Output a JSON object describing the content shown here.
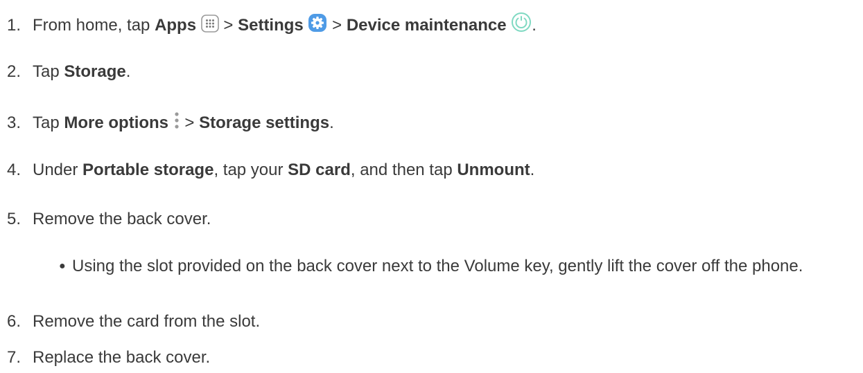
{
  "steps": [
    {
      "number": "1.",
      "t1": "From home, tap ",
      "b1": "Apps",
      "sep1": " > ",
      "b2": "Settings",
      "sep2": " > ",
      "b3": "Device maintenance",
      "end": ".",
      "icons": [
        "apps-grid-icon",
        "settings-gear-icon",
        "device-maintenance-icon"
      ]
    },
    {
      "number": "2.",
      "t1": "Tap ",
      "b1": "Storage",
      "end": "."
    },
    {
      "number": "3.",
      "t1": "Tap ",
      "b1": "More options",
      "sep1": " > ",
      "b2": "Storage settings",
      "end": ".",
      "icons": [
        "more-options-icon"
      ]
    },
    {
      "number": "4.",
      "t1": "Under ",
      "b1": "Portable storage",
      "t2": ", tap your ",
      "b2": "SD card",
      "t3": ", and then tap ",
      "b3": "Unmount",
      "end": "."
    },
    {
      "number": "5.",
      "t1": "Remove the back cover.",
      "sub": "Using the slot provided on the back cover next to the Volume key, gently lift the cover off the phone."
    },
    {
      "number": "6.",
      "t1": "Remove the card from the slot."
    },
    {
      "number": "7.",
      "t1": "Replace the back cover."
    }
  ],
  "colors": {
    "text": "#3a3a3a",
    "settings_blue": "#4f9be6",
    "maintenance_green": "#7fd9c2",
    "icon_grey": "#8a8a8a"
  }
}
